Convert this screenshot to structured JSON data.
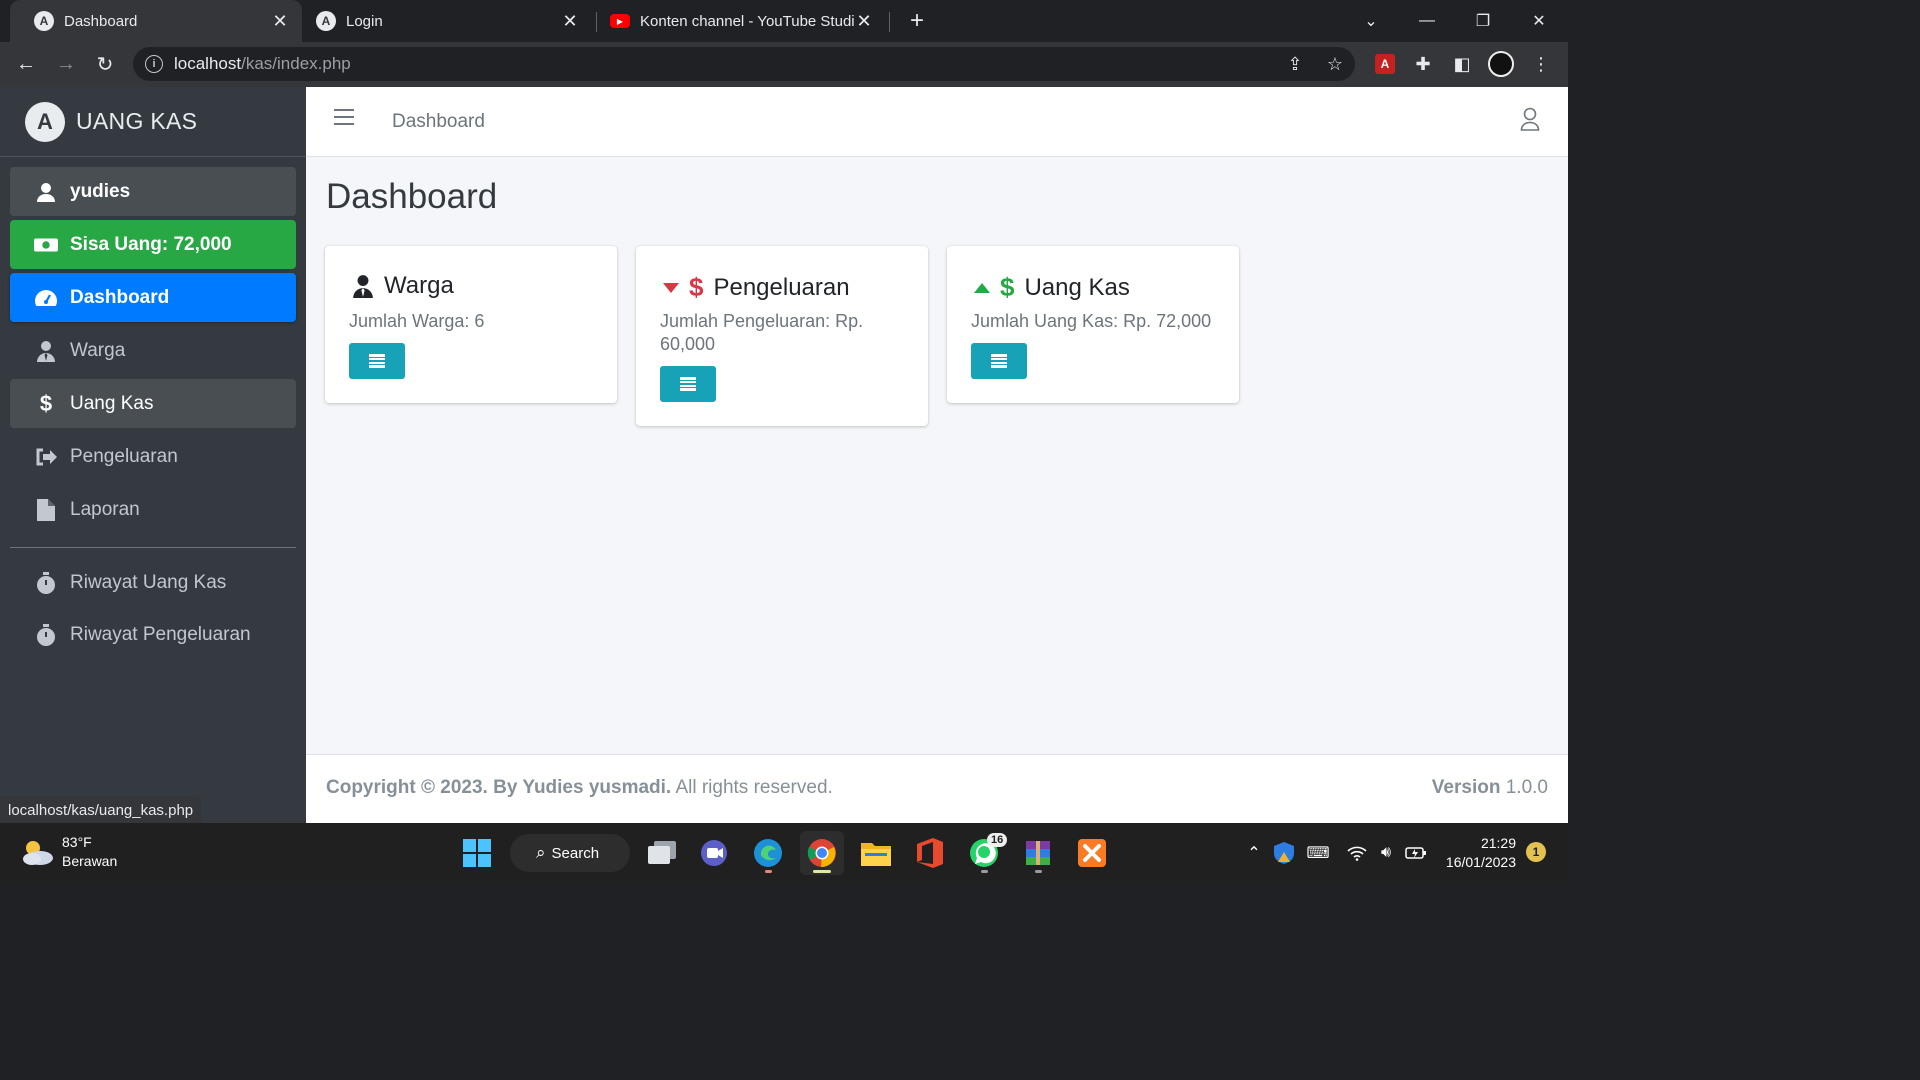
{
  "browser": {
    "tabs": [
      {
        "title": "Dashboard",
        "active": true
      },
      {
        "title": "Login",
        "active": false
      },
      {
        "title": "Konten channel - YouTube Studio",
        "active": false
      }
    ],
    "url_host": "localhost",
    "url_path": "/kas/index.php",
    "status_url": "localhost/kas/uang_kas.php"
  },
  "sidebar": {
    "brand": "UANG KAS",
    "user": "yudies",
    "balance": "Sisa Uang: 72,000",
    "items": [
      {
        "label": "Dashboard",
        "icon": "tachometer-icon"
      },
      {
        "label": "Warga",
        "icon": "user-tie-icon"
      },
      {
        "label": "Uang Kas",
        "icon": "dollar-icon"
      },
      {
        "label": "Pengeluaran",
        "icon": "sign-out-icon"
      },
      {
        "label": "Laporan",
        "icon": "file-icon"
      }
    ],
    "history": [
      {
        "label": "Riwayat Uang Kas",
        "icon": "stopwatch-icon"
      },
      {
        "label": "Riwayat Pengeluaran",
        "icon": "stopwatch-icon"
      }
    ]
  },
  "topnav": {
    "link": "Dashboard"
  },
  "page": {
    "title": "Dashboard",
    "cards": [
      {
        "title": "Warga",
        "text": "Jumlah Warga: 6"
      },
      {
        "title": "Pengeluaran",
        "text": "Jumlah Pengeluaran: Rp. 60,000"
      },
      {
        "title": "Uang Kas",
        "text": "Jumlah Uang Kas: Rp. 72,000"
      }
    ]
  },
  "footer": {
    "copyright_bold": "Copyright © 2023. By Yudies yusmadi.",
    "copyright_rest": " All rights reserved.",
    "version_label": "Version",
    "version_value": " 1.0.0"
  },
  "taskbar": {
    "temperature": "83°F",
    "weather": "Berawan",
    "search": "Search",
    "time": "21:29",
    "date": "16/01/2023",
    "notifications": "1",
    "whatsapp_badge": "16"
  },
  "colors": {
    "sidebar_bg": "#343a40",
    "balance_green": "#28a745",
    "active_blue": "#007bff",
    "card_button": "#17a2b8",
    "down_red": "#dc3545",
    "up_green": "#28a745"
  }
}
